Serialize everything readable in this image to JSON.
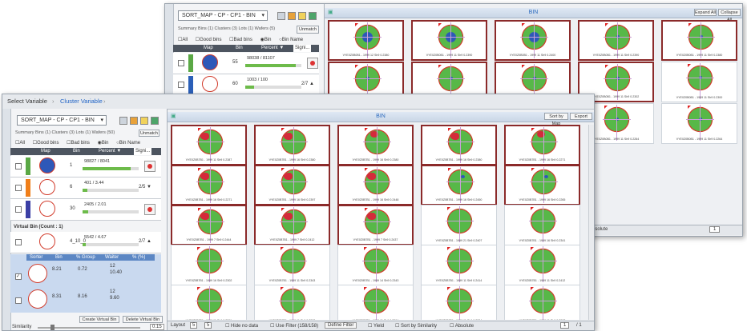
{
  "back": {
    "dropdown": "SORT_MAP - CP - CP1 - BIN",
    "summary": "Summary Bins (1) Clusters (3) Lots (1) Wafers (5)",
    "button_unmatch": "Unmatch",
    "options": [
      "All",
      "Good bins",
      "Bad bins",
      "Bin",
      "Bin Name"
    ],
    "headers": {
      "map": "Map",
      "bin": "Bin",
      "percent": "Percent ▼",
      "sig": "Signi..."
    },
    "rows": [
      {
        "count": "55",
        "pct": "98038 / 81107",
        "fill": 0.9,
        "color": "#5aa845",
        "wafer": "blue"
      },
      {
        "count": "60",
        "pct": "1003 / 100",
        "fill": 0.15,
        "color": "#2b5fb8",
        "page": "2/7 ▲",
        "wafer": "red"
      }
    ],
    "bin_title": "BIN",
    "btn_sort": "Expand All",
    "btn_close": "Collapse All",
    "footer": {
      "absolute": "Absolute",
      "page": "1"
    },
    "tiles": [
      {
        "label": "VYE0Z0B0B1 - 1999 12 Sh9 0.2380",
        "blue": true,
        "sel": true
      },
      {
        "label": "VYE0Z0B0B1 - 1999 11 Sh9 0.2390",
        "blue": true,
        "sel": true
      },
      {
        "label": "VYE0Z0B0B1 - 1999 11 Sh9 0.2400",
        "blue": true,
        "sel": true
      },
      {
        "label": "VYE0Z0B0B1 - 1999 11 Sh9 0.2390",
        "blue": false,
        "sel": true
      },
      {
        "label": "VYE0Z0B0B1 - 1999 11 Sh9 0.2380",
        "blue": false,
        "sel": true
      },
      {
        "label": "VYE0Z0B0B1 - 1999 11 Sh9 0.2350",
        "blue": false,
        "sel": true
      },
      {
        "label": "VYE0Z0B0B1 - 1999 11 Sh9 0.2340",
        "blue": false,
        "sel": true
      },
      {
        "label": "VYE0Z0B0B1 - 1999 11 Sh9 0.2310",
        "blue": false,
        "sel": true
      },
      {
        "label": "VYE0Z0B0B1 - 1999 11 Sh9 0.2302",
        "blue": false,
        "sel": true
      },
      {
        "label": "VYE0Z0B0B1 - 1999 11 Sh9 0.2300",
        "blue": false,
        "sel": false
      },
      {
        "label": "VYE0Z0B0B1 - 1999 11 Sh9 0.2271",
        "blue": false,
        "sel": false
      },
      {
        "label": "VYE0Z0B0B1 - 1999 11 Sh9 0.2271",
        "blue": false,
        "sel": false
      },
      {
        "label": "VYE0Z0B0B1 - 1999 11 Sh9 0.2264",
        "blue": false,
        "sel": false
      },
      {
        "label": "VYE0Z0B0B1 - 1999 11 Sh9 0.2264",
        "blue": false,
        "sel": false
      },
      {
        "label": "VYE0Z0B0B1 - 1999 11 Sh9 0.2264",
        "blue": false,
        "sel": false
      }
    ]
  },
  "front": {
    "crumb1": "Select Variable",
    "crumb2": "Cluster Variable",
    "dropdown": "SORT_MAP - CP - CP1 - BIN",
    "summary": "Summary Bins (1) Clusters (3) Lots (1) Wafers (50)",
    "button_unmatch": "Unmatch",
    "options": [
      "All",
      "Good bins",
      "Bad bins",
      "Bin",
      "Bin Name"
    ],
    "headers": {
      "map": "Map",
      "bin": "Bin",
      "percent": "Percent ▼",
      "sig": "Signi..."
    },
    "rows": [
      {
        "count": "1",
        "pct": "98827 / 8041",
        "fill": 0.85,
        "color": "#5aa845",
        "wafer": "blue"
      },
      {
        "count": "6",
        "pct": "401 / 3.44",
        "fill": 0.08,
        "color": "#f07f1a",
        "page": "2/5 ▼",
        "wafer": "ring"
      },
      {
        "count": "30",
        "pct": "2405 / 2.01",
        "fill": 0.1,
        "color": "#3b3fa5",
        "wafer": "ring"
      }
    ],
    "virtual_title": "Virtual Bin (Count : 1)",
    "virtual_row": {
      "count": "4_10_0",
      "pct": "5542 / 4.67",
      "page": "2/7 ▲"
    },
    "sub_headers": [
      "Sorter",
      "Bin",
      "% Group",
      "Waiter",
      "% (%)"
    ],
    "sub_rows": [
      {
        "a": "8.21",
        "b": "0.72",
        "c": "12",
        "d": "10.40"
      },
      {
        "a": "8.31",
        "b": "8.16",
        "c": "12",
        "d": "9.60"
      }
    ],
    "btn_create_virtual": "Create Virtual Bin",
    "btn_delete_virtual": "Delete Virtual Bin",
    "similarity_label": "Similarity",
    "similarity_value": "0.15",
    "bin_title": "BIN",
    "btn_sort": "Sort by Map",
    "btn_export": "Export",
    "footer": {
      "layout": "Layout",
      "cols": "5",
      "rows": "5",
      "hide_no_data": "Hide no data",
      "use_filter": "Use Filter (158/158)",
      "define_filter": "Define Filter",
      "yield": "Yield",
      "sort_similarity": "Sort by Similarity",
      "absolute": "Absolute",
      "page": "1",
      "page_total": "/ 1"
    },
    "tiles": [
      {
        "label": "VYE0Z0B7B1 - 1999 11 Sh9 0.2387",
        "w": "red",
        "sel": true
      },
      {
        "label": "VYE0Z0B7B1 - 1999 16 Sh9 0.2380",
        "w": "red",
        "sel": true
      },
      {
        "label": "VYE0Z0B7B1 - 1999 16 Sh9 0.2380",
        "w": "redtop",
        "sel": true
      },
      {
        "label": "VYE0Z0B7B1 - 1999 16 Sh9 0.2380",
        "w": "red",
        "sel": true
      },
      {
        "label": "VYE0Z0B7B1 - 1999 16 Sh9 0.2271",
        "w": "redtop",
        "sel": true
      },
      {
        "label": "VYE0Z0B7B1 - 1999 16 Sh9 0.2271",
        "w": "red",
        "sel": true
      },
      {
        "label": "VYE0Z0B7B1 - 1999 16 Sh9 0.2397",
        "w": "red",
        "sel": true
      },
      {
        "label": "VYE0Z0B7B1 - 1999 16 Sh9 0.2448",
        "w": "red",
        "sel": true
      },
      {
        "label": "VYE0Z0B7B1 - 1999 16 Sh9 0.2450",
        "w": "bluedot",
        "sel": true
      },
      {
        "label": "VYE0Z0B7B1 - 1999 16 Sh9 0.2265",
        "w": "bluedot",
        "sel": true
      },
      {
        "label": "VYE0Z0B7B1 - 1999 7 Sh9 0.2444",
        "w": "red",
        "sel": true
      },
      {
        "label": "VYE0Z0B7B1 - 1999 7 Sh9 0.2412",
        "w": "red",
        "sel": true
      },
      {
        "label": "VYE0Z0B7B1 - 1999 7 Sh9 0.2437",
        "w": "red",
        "sel": true
      },
      {
        "label": "VYE0Z0B7B1 - 1999 21 Sh9 0.2407",
        "w": "",
        "sel": false
      },
      {
        "label": "VYE0Z0B7B1 - 1999 16 Sh9 0.2341",
        "w": "",
        "sel": false
      },
      {
        "label": "VYE0Z0B7B1 - 1999 16 Sh9 0.2302",
        "w": "",
        "sel": false
      },
      {
        "label": "VYE0Z0B7B1 - 1999 11 Sh9 0.2343",
        "w": "",
        "sel": false
      },
      {
        "label": "VYE0Z0B7B1 - 1999 14 Sh9 0.2343",
        "w": "",
        "sel": false
      },
      {
        "label": "VYE0Z0B7B1 - 1999 11 Sh9 0.2414",
        "w": "",
        "sel": false
      },
      {
        "label": "VYE0Z0B7B1 - 1999 11 Sh9 0.2412",
        "w": "",
        "sel": false
      },
      {
        "label": "VYE0Z0B7B1 - 1999 11 Sh9 0.2301",
        "w": "",
        "sel": false
      },
      {
        "label": "VYE0Z0B7B1 - 1999 11 Sh9 0.2302",
        "w": "",
        "sel": false
      },
      {
        "label": "VYE0Z0B7B1 - 1999 11 Sh9 0.2304",
        "w": "",
        "sel": false
      },
      {
        "label": "VYE0Z0B7B1 - 1999 11 Sh9 0.2324",
        "w": "",
        "sel": false
      },
      {
        "label": "VYE0Z0B7B1 - 1999 11 Sh9 0.2287",
        "w": "",
        "sel": false
      }
    ]
  }
}
